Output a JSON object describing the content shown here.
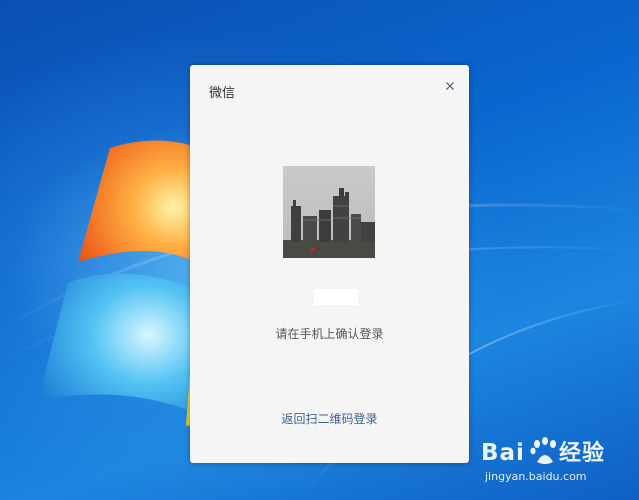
{
  "dialog": {
    "title": "微信",
    "close_icon": "close-icon",
    "avatar_icon": "avatar-photo",
    "account_name": "",
    "confirm_hint": "请在手机上确认登录",
    "back_link": "返回扫二维码登录"
  },
  "watermark": {
    "logo_text": "Bai du 经验",
    "url": "jingyan.baidu.com"
  },
  "colors": {
    "dialog_bg": "#f5f5f5",
    "link": "#3f5f8e",
    "desktop_blue": "#0a67cf"
  }
}
